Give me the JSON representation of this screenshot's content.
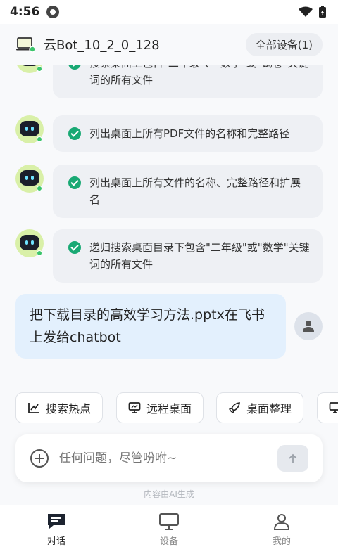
{
  "status_bar": {
    "time": "4:56"
  },
  "header": {
    "device_name": "云Bot_10_2_0_128",
    "all_devices_label": "全部设备(1)"
  },
  "messages": [
    {
      "role": "bot",
      "text": "搜索桌面上包含\"二年级\"、\"数学\"或\"试卷\"关键词的所有文件"
    },
    {
      "role": "bot",
      "text": "列出桌面上所有PDF文件的名称和完整路径"
    },
    {
      "role": "bot",
      "text": "列出桌面上所有文件的名称、完整路径和扩展名"
    },
    {
      "role": "bot",
      "text": "递归搜索桌面目录下包含\"二年级\"或\"数学\"关键词的所有文件"
    },
    {
      "role": "user",
      "text": "把下载目录的高效学习方法.pptx在飞书上发给chatbot"
    }
  ],
  "quick_actions": [
    {
      "label": "搜索热点",
      "icon": "chart-icon"
    },
    {
      "label": "远程桌面",
      "icon": "monitor-icon"
    },
    {
      "label": "桌面整理",
      "icon": "rocket-icon"
    },
    {
      "label": "",
      "icon": "monitor-icon"
    }
  ],
  "input": {
    "placeholder": "任何问题，尽管吩咐~"
  },
  "footer_note": "内容由AI生成",
  "tabs": [
    {
      "label": "对话",
      "active": true
    },
    {
      "label": "设备",
      "active": false
    },
    {
      "label": "我的",
      "active": false
    }
  ],
  "colors": {
    "accent_green": "#19a974",
    "user_bubble": "#e3f0fd",
    "bot_bubble": "#eef0f4"
  }
}
